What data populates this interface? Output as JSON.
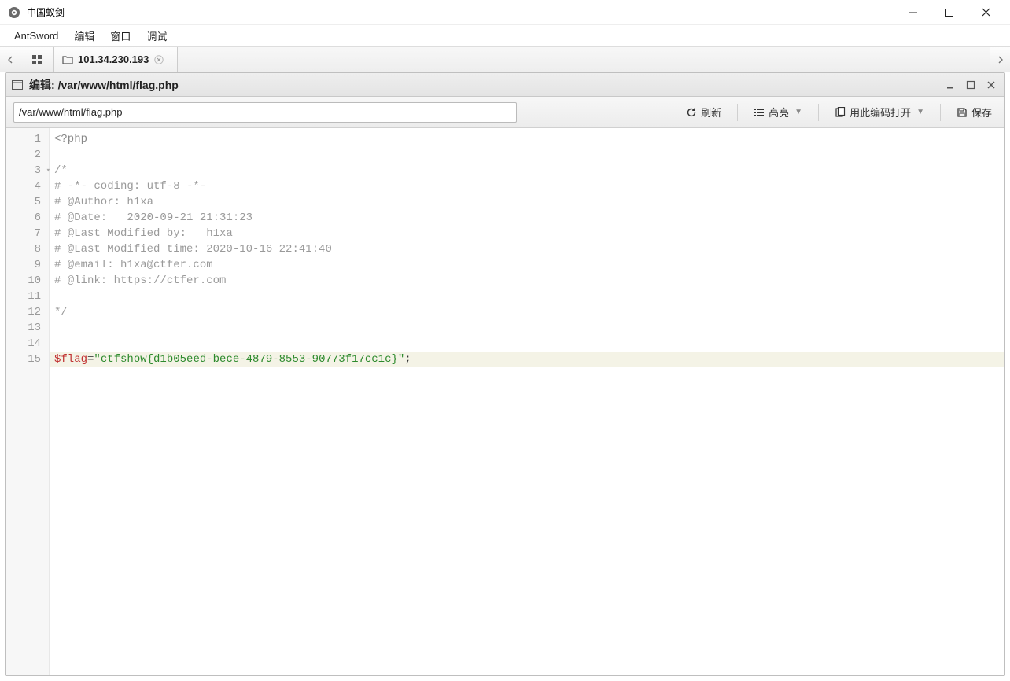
{
  "window": {
    "title": "中国蚁剑"
  },
  "menu": {
    "items": [
      "AntSword",
      "编辑",
      "窗口",
      "调试"
    ]
  },
  "tabs": {
    "active_ip": "101.34.230.193"
  },
  "panel": {
    "title_prefix": "编辑: ",
    "title_path": "/var/www/html/flag.php"
  },
  "toolbar": {
    "path_value": "/var/www/html/flag.php",
    "refresh_label": "刷新",
    "highlight_label": "高亮",
    "open_with_encoding_label": "用此编码打开",
    "save_label": "保存"
  },
  "editor": {
    "active_line": 15,
    "lines": [
      {
        "n": 1,
        "type": "code",
        "tokens": [
          {
            "c": "tag",
            "t": "<?php"
          }
        ]
      },
      {
        "n": 2,
        "type": "blank"
      },
      {
        "n": 3,
        "type": "comment",
        "fold": true,
        "text": "/*"
      },
      {
        "n": 4,
        "type": "comment",
        "text": "# -*- coding: utf-8 -*-"
      },
      {
        "n": 5,
        "type": "comment",
        "text": "# @Author: h1xa"
      },
      {
        "n": 6,
        "type": "comment",
        "text": "# @Date:   2020-09-21 21:31:23"
      },
      {
        "n": 7,
        "type": "comment",
        "text": "# @Last Modified by:   h1xa"
      },
      {
        "n": 8,
        "type": "comment",
        "text": "# @Last Modified time: 2020-10-16 22:41:40"
      },
      {
        "n": 9,
        "type": "comment",
        "text": "# @email: h1xa@ctfer.com"
      },
      {
        "n": 10,
        "type": "comment",
        "text": "# @link: https://ctfer.com"
      },
      {
        "n": 11,
        "type": "blank"
      },
      {
        "n": 12,
        "type": "comment",
        "text": "*/"
      },
      {
        "n": 13,
        "type": "blank"
      },
      {
        "n": 14,
        "type": "blank"
      },
      {
        "n": 15,
        "type": "code",
        "tokens": [
          {
            "c": "var",
            "t": "$flag"
          },
          {
            "c": "op",
            "t": "="
          },
          {
            "c": "str",
            "t": "\"ctfshow{d1b05eed-bece-4879-8553-90773f17cc1c}\""
          },
          {
            "c": "punct",
            "t": ";"
          }
        ]
      }
    ]
  }
}
